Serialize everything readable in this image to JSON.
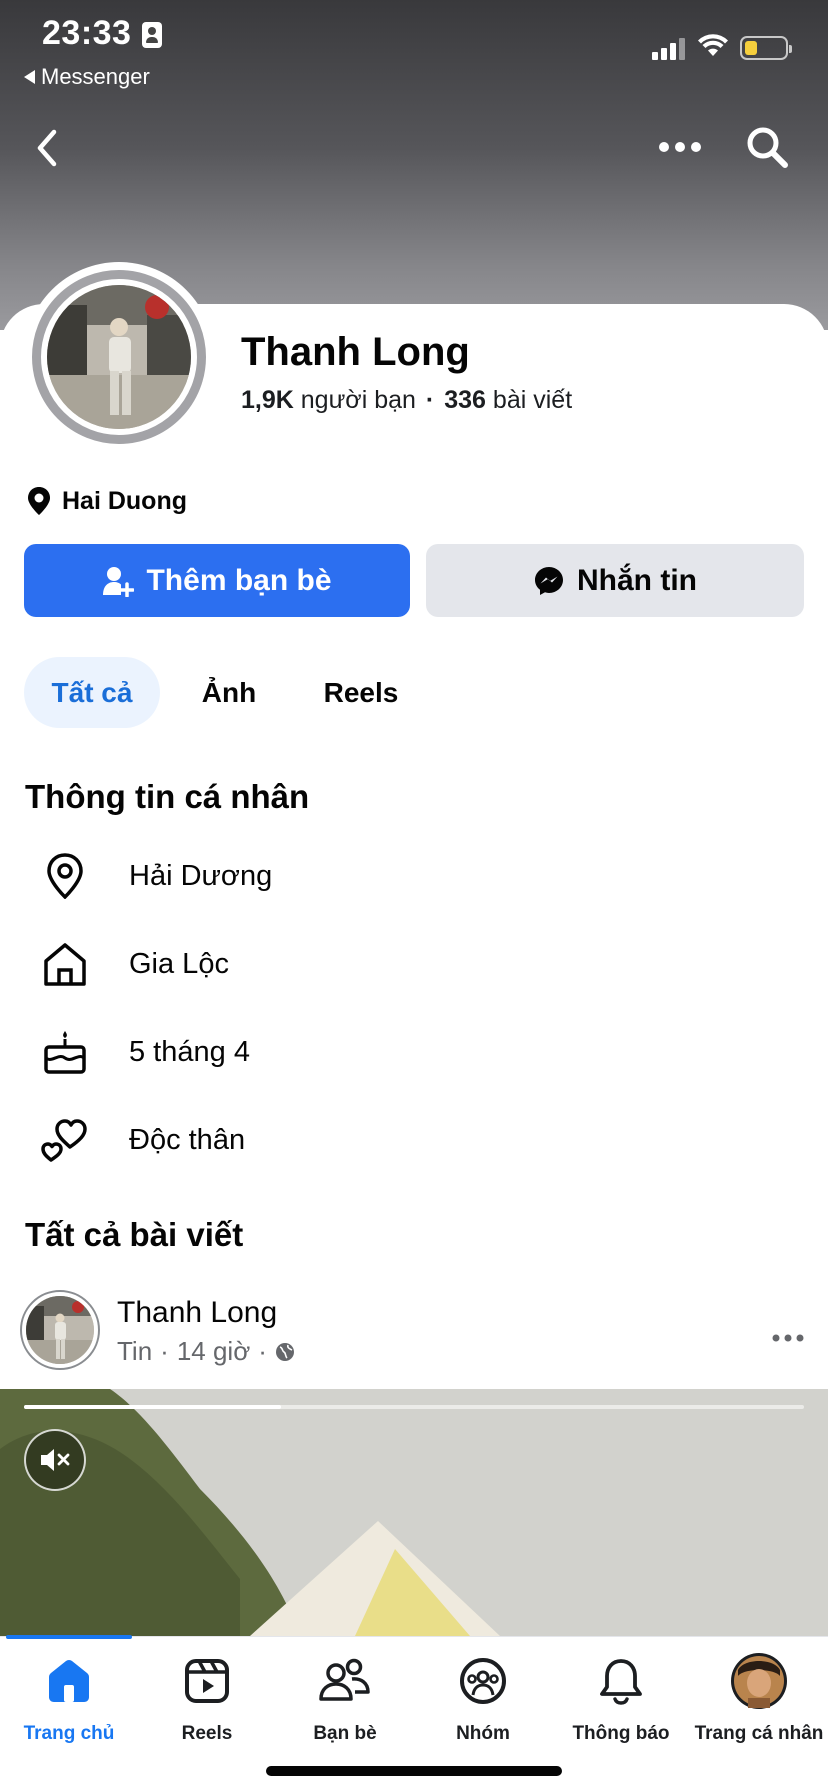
{
  "status_bar": {
    "time": "23:33",
    "back_app_label": "Messenger"
  },
  "profile": {
    "name": "Thanh Long",
    "friends_count": "1,9K",
    "friends_label": "người bạn",
    "separator": "·",
    "posts_count": "336",
    "posts_label": "bài viết",
    "location": "Hai Duong"
  },
  "actions": {
    "add_friend_label": "Thêm bạn bè",
    "message_label": "Nhắn tin"
  },
  "tabs": [
    {
      "label": "Tất cả",
      "selected": true
    },
    {
      "label": "Ảnh",
      "selected": false
    },
    {
      "label": "Reels",
      "selected": false
    }
  ],
  "personal_info": {
    "title": "Thông tin cá nhân",
    "items": [
      {
        "icon": "location-pin-icon",
        "text": "Hải Dương"
      },
      {
        "icon": "home-icon",
        "text": "Gia Lộc"
      },
      {
        "icon": "birthday-cake-icon",
        "text": "5 tháng 4"
      },
      {
        "icon": "hearts-icon",
        "text": "Độc thân"
      }
    ]
  },
  "posts": {
    "title": "Tất cả bài viết",
    "items": [
      {
        "author": "Thanh Long",
        "type": "Tin",
        "sep": "·",
        "time": "14 giờ",
        "audience_icon": "globe-icon",
        "progress": 0.33
      }
    ]
  },
  "bottom_nav": [
    {
      "label": "Trang chủ",
      "icon": "home-icon",
      "active": true
    },
    {
      "label": "Reels",
      "icon": "reels-icon",
      "active": false
    },
    {
      "label": "Bạn bè",
      "icon": "friends-icon",
      "active": false
    },
    {
      "label": "Nhóm",
      "icon": "groups-icon",
      "active": false
    },
    {
      "label": "Thông báo",
      "icon": "bell-icon",
      "active": false
    },
    {
      "label": "Trang cá nhân",
      "icon": "profile-avatar",
      "active": false
    }
  ],
  "colors": {
    "primary": "#2C6FF0",
    "active_nav": "#1877F2",
    "tab_selected_bg": "#EBF3FE",
    "secondary_button": "#E4E6EB"
  }
}
